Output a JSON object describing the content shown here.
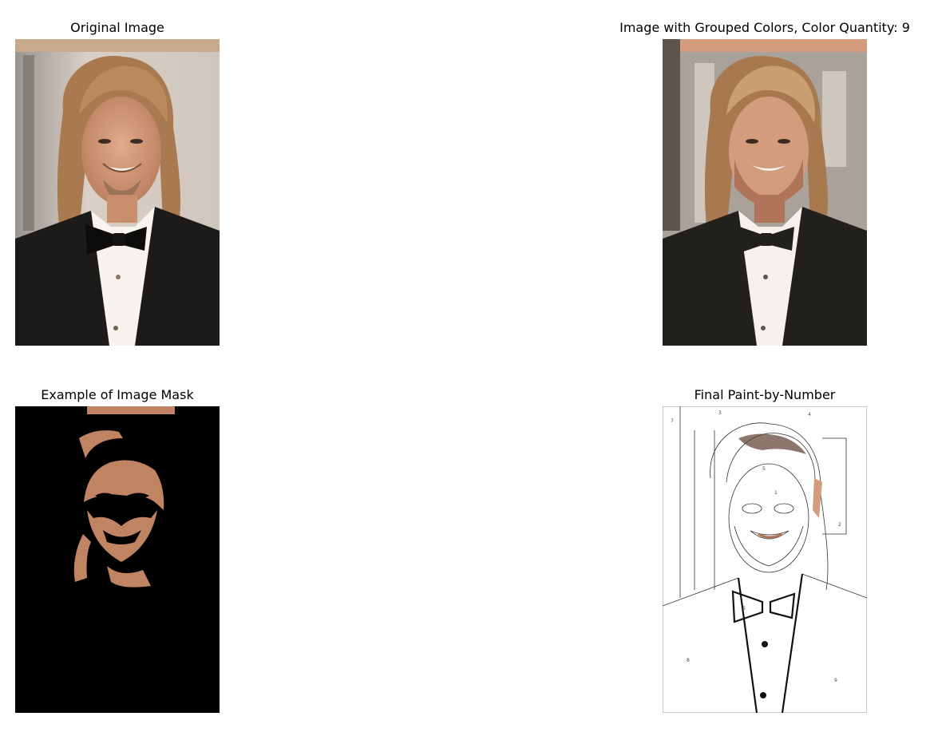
{
  "panels": [
    {
      "title": "Original Image"
    },
    {
      "title": "Image with Grouped Colors, Color Quantity: 9"
    },
    {
      "title": "Example of Image Mask"
    },
    {
      "title": "Final Paint-by-Number"
    }
  ],
  "palette": {
    "skin": "#d39c7c",
    "skin_shadow": "#b07458",
    "hair": "#a8784f",
    "hair_light": "#c9a070",
    "suit": "#22201c",
    "shirt": "#f6f1ec",
    "bg_warm": "#d8c9bd",
    "bg_grey": "#a9a29b",
    "mask_fg": "#c08462",
    "mask_bg": "#000000"
  },
  "paint_by_number_labels": [
    "7",
    "3",
    "5",
    "8",
    "2",
    "6",
    "9",
    "4",
    "1"
  ]
}
